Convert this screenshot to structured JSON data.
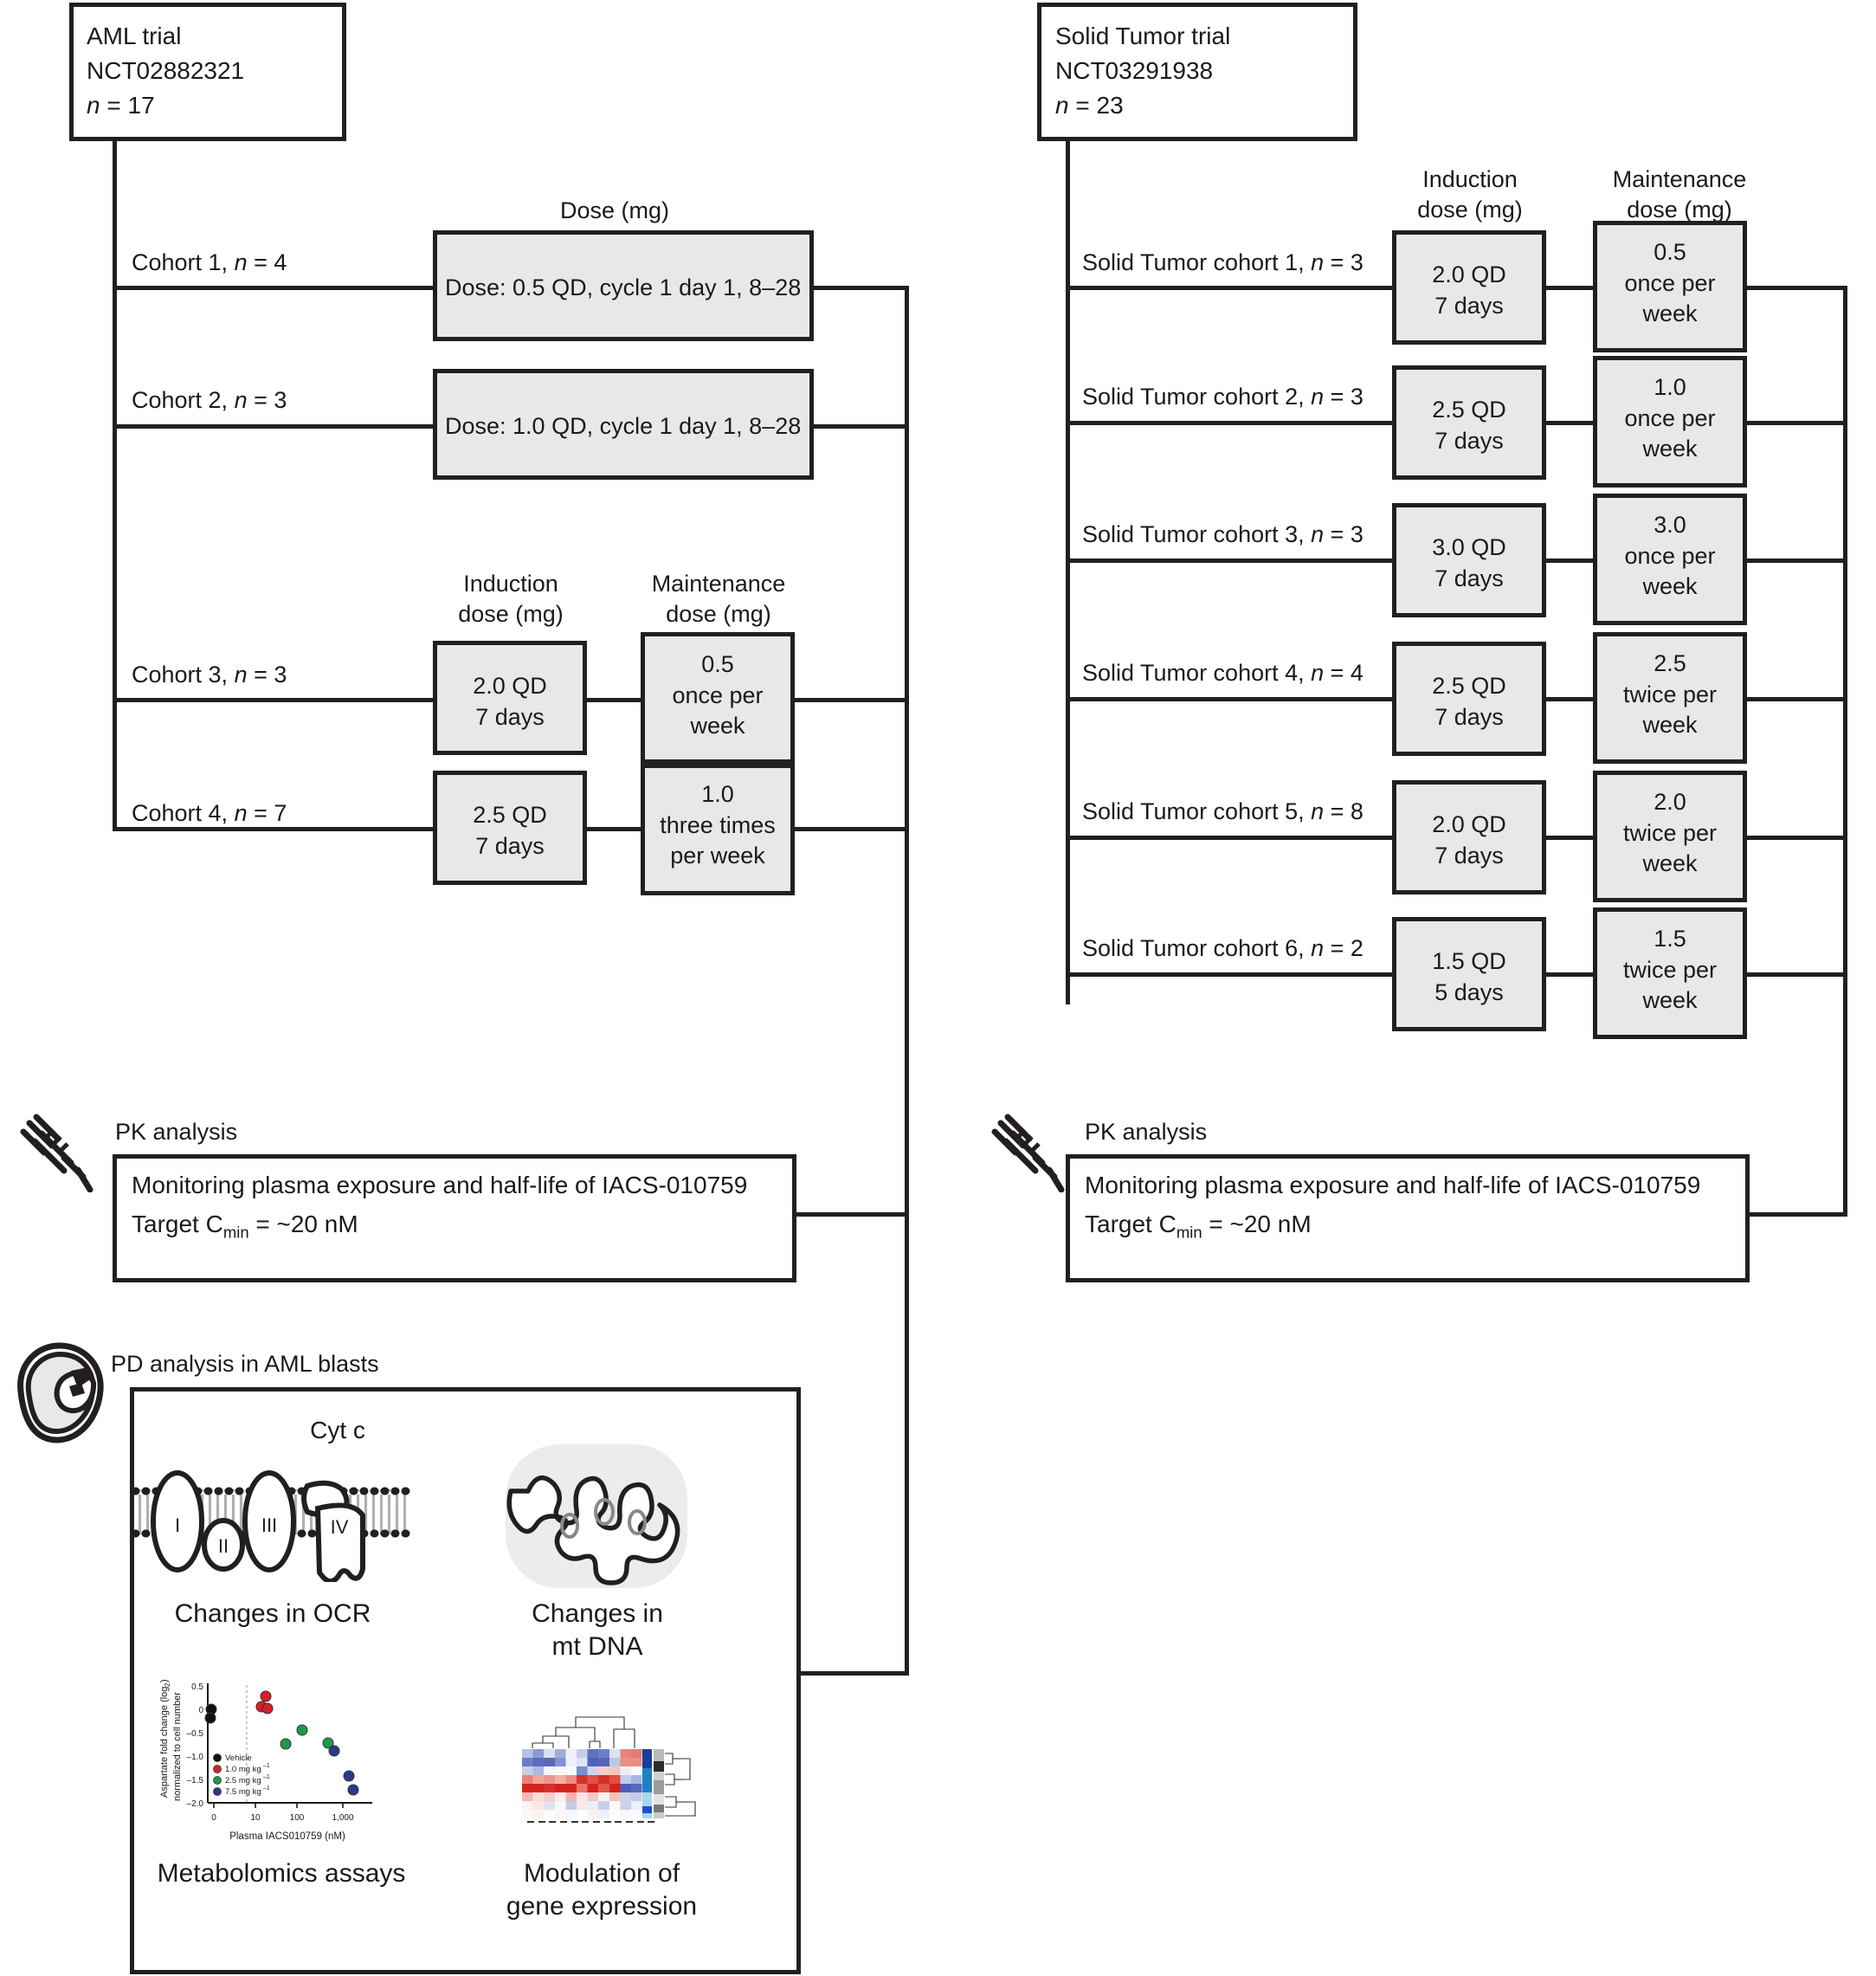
{
  "aml_trial": {
    "title": "AML trial",
    "registry_id": "NCT02882321",
    "n_label": "n",
    "n_value": "= 17",
    "dose_header": "Dose (mg)",
    "induction_header": "Induction\ndose (mg)",
    "maintenance_header": "Maintenance\ndose (mg)",
    "cohorts": [
      {
        "label_pre": "Cohort 1, ",
        "label_n": "n",
        "label_post": " = 4",
        "dose": "Dose: 0.5 QD, cycle 1 day 1, 8–28",
        "style": "wide"
      },
      {
        "label_pre": "Cohort 2, ",
        "label_n": "n",
        "label_post": " = 3",
        "dose": "Dose: 1.0 QD, cycle 1 day 1, 8–28",
        "style": "wide"
      },
      {
        "label_pre": "Cohort 3, ",
        "label_n": "n",
        "label_post": " = 3",
        "induction": "2.0 QD\n7 days",
        "maintenance": "0.5\nonce per\nweek",
        "style": "split"
      },
      {
        "label_pre": "Cohort 4, ",
        "label_n": "n",
        "label_post": " = 7",
        "induction": "2.5 QD\n7 days",
        "maintenance": "1.0\nthree times\nper week",
        "style": "split"
      }
    ],
    "pk": {
      "heading": "PK analysis",
      "line1": "Monitoring plasma exposure and half-life of IACS-010759",
      "line2_pre": "Target C",
      "line2_sub": "min",
      "line2_post": " = ~20 nM",
      "icon": "syringe-icon"
    },
    "pd": {
      "heading": "PD analysis in AML blasts",
      "icon": "blast-cell-icon",
      "panels": [
        {
          "caption": "Changes in OCR",
          "graphic": "respiratory-chain-icon",
          "annotation": "Cyt c",
          "complexes": [
            "I",
            "II",
            "III",
            "IV"
          ]
        },
        {
          "caption": "Changes in\nmt DNA",
          "graphic": "mitochondrion-icon"
        },
        {
          "caption": "Metabolomics assays",
          "graphic": "scatter-plot"
        },
        {
          "caption": "Modulation of\ngene expression",
          "graphic": "heatmap-dendrogram"
        }
      ]
    }
  },
  "solid_tumor_trial": {
    "title": "Solid Tumor trial",
    "registry_id": "NCT03291938",
    "n_label": "n",
    "n_value": "= 23",
    "induction_header": "Induction\ndose (mg)",
    "maintenance_header": "Maintenance\ndose (mg)",
    "cohorts": [
      {
        "label_pre": "Solid Tumor cohort 1, ",
        "label_n": "n",
        "label_post": " = 3",
        "induction": "2.0 QD\n7 days",
        "maintenance": "0.5\nonce per\nweek"
      },
      {
        "label_pre": "Solid Tumor cohort 2, ",
        "label_n": "n",
        "label_post": " = 3",
        "induction": "2.5 QD\n7 days",
        "maintenance": "1.0\nonce per\nweek"
      },
      {
        "label_pre": "Solid Tumor cohort 3, ",
        "label_n": "n",
        "label_post": " = 3",
        "induction": "3.0 QD\n7 days",
        "maintenance": "3.0\nonce per\nweek"
      },
      {
        "label_pre": "Solid Tumor cohort 4, ",
        "label_n": "n",
        "label_post": " = 4",
        "induction": "2.5 QD\n7 days",
        "maintenance": "2.5\ntwice per\nweek"
      },
      {
        "label_pre": "Solid Tumor cohort 5, ",
        "label_n": "n",
        "label_post": " = 8",
        "induction": "2.0 QD\n7 days",
        "maintenance": "2.0\ntwice per\nweek"
      },
      {
        "label_pre": "Solid Tumor cohort 6, ",
        "label_n": "n",
        "label_post": " = 2",
        "induction": "1.5 QD\n5 days",
        "maintenance": "1.5\ntwice per\nweek"
      }
    ],
    "pk": {
      "heading": "PK analysis",
      "line1": "Monitoring plasma exposure and half-life of IACS-010759",
      "line2_pre": "Target C",
      "line2_sub": "min",
      "line2_post": " = ~20 nM",
      "icon": "syringe-icon"
    }
  },
  "chart_data": {
    "type": "scatter",
    "title": "",
    "xlabel": "Plasma IACS010759 (nM)",
    "ylabel": "Aspartate fold change (log₂)\nnormalized to cell number",
    "xticks": [
      "0",
      "10",
      "100",
      "1,000"
    ],
    "yticks": [
      "0.5",
      "0",
      "−0.5",
      "−1.0",
      "−1.5",
      "−2.0"
    ],
    "ylim": [
      -2.0,
      0.5
    ],
    "legend_position": "inside-left",
    "series": [
      {
        "name": "Vehicle",
        "color": "#111111",
        "points": [
          [
            0.4,
            0.07
          ],
          [
            0.4,
            -0.12
          ]
        ]
      },
      {
        "name": "1.0 mg kg⁻¹",
        "color": "#d81f26",
        "points": [
          [
            33,
            0.29
          ],
          [
            31,
            0.13
          ],
          [
            35,
            0.11
          ]
        ]
      },
      {
        "name": "2.5 mg kg⁻¹",
        "color": "#1c9a4a",
        "points": [
          [
            72,
            -0.66
          ],
          [
            115,
            -0.36
          ],
          [
            440,
            -0.65
          ]
        ]
      },
      {
        "name": "7.5 mg kg⁻¹",
        "color": "#2a3a8c",
        "points": [
          [
            520,
            -0.81
          ],
          [
            790,
            -1.35
          ],
          [
            880,
            -1.65
          ]
        ]
      }
    ],
    "threshold_line": 20
  }
}
